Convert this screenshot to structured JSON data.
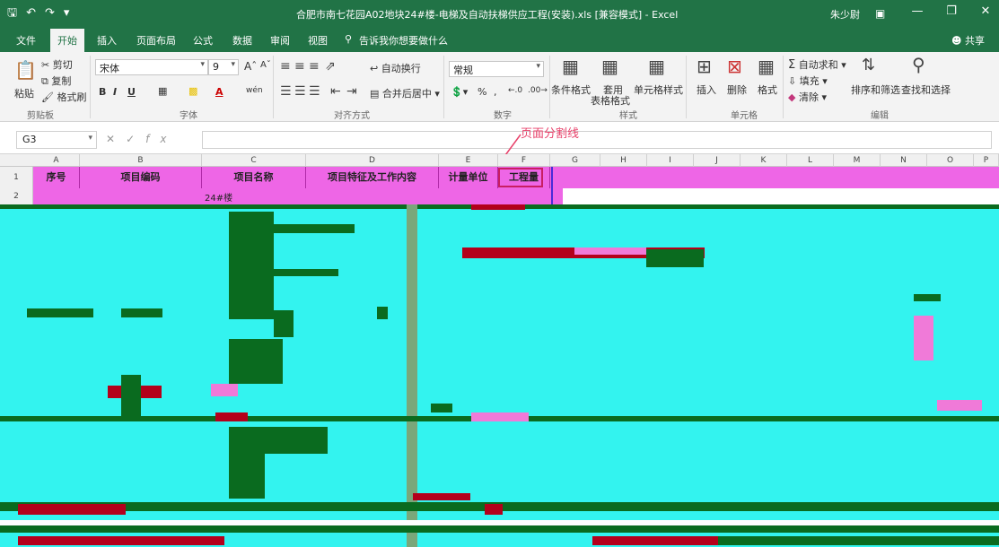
{
  "window": {
    "title": "合肥市南七花园A02地块24#楼-电梯及自动扶梯供应工程(安装).xls [兼容模式] - Excel",
    "user": "朱少尉"
  },
  "qat": {
    "save_icon": "save-icon",
    "undo_icon": "undo-icon",
    "redo_icon": "redo-icon"
  },
  "tabs": {
    "file": "文件",
    "home": "开始",
    "insert": "插入",
    "page_layout": "页面布局",
    "formulas": "公式",
    "data": "数据",
    "review": "审阅",
    "view": "视图",
    "tell_me": "告诉我你想要做什么",
    "share": "共享"
  },
  "ribbon": {
    "clipboard": {
      "cut": "剪切",
      "copy": "复制",
      "paste": "粘贴",
      "format_painter": "格式刷",
      "label": "剪贴板"
    },
    "font": {
      "font_name": "宋体",
      "font_size": "9",
      "bold": "B",
      "italic": "I",
      "underline": "U",
      "font_color": "A",
      "phonetic": "wén",
      "label": "字体"
    },
    "alignment": {
      "wrap_text": "自动换行",
      "merge_center": "合并后居中",
      "label": "对齐方式"
    },
    "number": {
      "format": "常规",
      "percent": "%",
      "comma": ",",
      "label": "数字"
    },
    "styles": {
      "conditional": "条件格式",
      "table_format_1": "套用",
      "table_format_2": "表格格式",
      "cell_styles": "单元格样式",
      "label": "样式"
    },
    "cells": {
      "insert": "插入",
      "delete": "删除",
      "format": "格式",
      "label": "单元格"
    },
    "editing": {
      "autosum": "自动求和",
      "fill": "填充",
      "clear": "清除",
      "sort_filter": "排序和筛选",
      "find_select": "查找和选择",
      "label": "编辑"
    }
  },
  "formula_bar": {
    "name_box": "G3",
    "fx": "fx"
  },
  "annotation": "页面分割线",
  "columns": [
    "A",
    "B",
    "C",
    "D",
    "E",
    "F",
    "G",
    "H",
    "I",
    "J",
    "K",
    "L",
    "M",
    "N",
    "O",
    "P"
  ],
  "rows": [
    "1",
    "2"
  ],
  "table_header": {
    "seq": "序号",
    "code": "项目编码",
    "name": "项目名称",
    "feature": "项目特征及工作内容",
    "unit": "计量单位",
    "qty": "工程量"
  },
  "row2": {
    "c": "24#楼"
  },
  "colors": {
    "excel_green": "#217346",
    "header_magenta": "#ee66e6",
    "glitch_cyan": "#33f3ef",
    "annotation_pink": "#e8426b"
  }
}
